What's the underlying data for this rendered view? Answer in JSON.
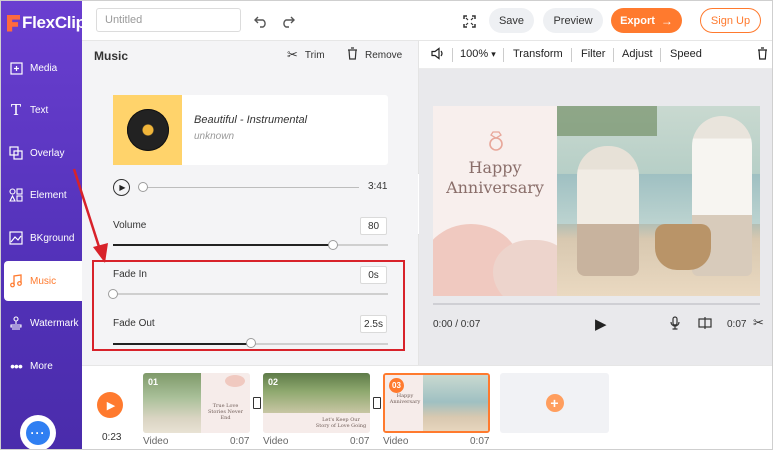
{
  "colors": {
    "brand_purple": "#5a36c2",
    "accent_orange": "#ff7a2e",
    "highlight_red": "#d8222a",
    "chat_blue": "#2f7ff2"
  },
  "app": {
    "logo_text": "FlexClip"
  },
  "sidebar": {
    "items": [
      {
        "label": "Media",
        "icon": "media-icon"
      },
      {
        "label": "Text",
        "icon": "text-icon"
      },
      {
        "label": "Overlay",
        "icon": "overlay-icon"
      },
      {
        "label": "Element",
        "icon": "element-icon"
      },
      {
        "label": "BKground",
        "icon": "background-icon"
      },
      {
        "label": "Music",
        "icon": "music-icon",
        "active": true
      },
      {
        "label": "Watermark",
        "icon": "watermark-icon"
      },
      {
        "label": "More",
        "icon": "more-icon"
      }
    ]
  },
  "topbar": {
    "title_placeholder": "Untitled",
    "save_label": "Save",
    "preview_label": "Preview",
    "export_label": "Export",
    "signup_label": "Sign Up"
  },
  "music_panel": {
    "title": "Music",
    "trim_label": "Trim",
    "remove_label": "Remove",
    "track_name": "Beautiful - Instrumental",
    "track_artist": "unknown",
    "track_duration": "3:41",
    "playback_progress": 0.0,
    "volume": {
      "label": "Volume",
      "value": "80",
      "level": 0.8
    },
    "fade_in": {
      "label": "Fade In",
      "value": "0s",
      "level": 0.0
    },
    "fade_out": {
      "label": "Fade Out",
      "value": "2.5s",
      "level": 0.5
    }
  },
  "preview_toolbar": {
    "zoom": "100%",
    "transform_label": "Transform",
    "filter_label": "Filter",
    "adjust_label": "Adjust",
    "speed_label": "Speed"
  },
  "preview": {
    "title_line1": "Happy",
    "title_line2": "Anniversary",
    "current_time": "0:00 / 0:07",
    "clip_duration": "0:07"
  },
  "timeline": {
    "total_time": "0:23",
    "clips": [
      {
        "number": "01",
        "type": "Video",
        "duration": "0:07",
        "caption": "True Love Stories Never End"
      },
      {
        "number": "02",
        "type": "Video",
        "duration": "0:07",
        "caption": "Let's Keep Our Story of Love Going"
      },
      {
        "number": "03",
        "type": "Video",
        "duration": "0:07",
        "caption": "Happy Anniversary",
        "selected": true
      }
    ]
  }
}
